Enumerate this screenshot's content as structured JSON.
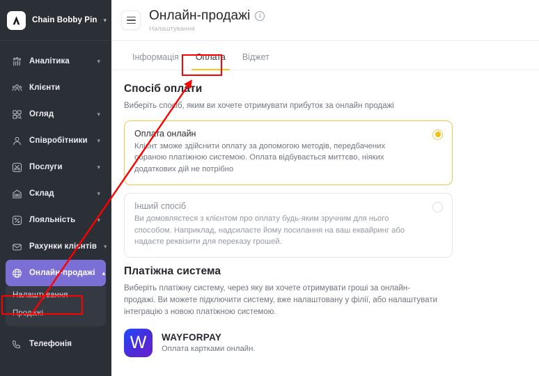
{
  "sidebar": {
    "brand": {
      "name": "Chain Bobby Pin",
      "chevron": "chevron-down"
    },
    "items": [
      {
        "label": "Аналітика",
        "icon": "analytics-icon",
        "has_chevron": true,
        "active": false
      },
      {
        "label": "Клієнти",
        "icon": "clients-icon",
        "has_chevron": false,
        "active": false
      },
      {
        "label": "Огляд",
        "icon": "overview-icon",
        "has_chevron": true,
        "active": false
      },
      {
        "label": "Співробітники",
        "icon": "employees-icon",
        "has_chevron": true,
        "active": false
      },
      {
        "label": "Послуги",
        "icon": "services-scissors-icon",
        "has_chevron": true,
        "active": false
      },
      {
        "label": "Склад",
        "icon": "warehouse-icon",
        "has_chevron": true,
        "active": false
      },
      {
        "label": "Лояльність",
        "icon": "loyalty-percent-icon",
        "has_chevron": true,
        "active": false
      },
      {
        "label": "Рахунки клієнтів",
        "icon": "client-accounts-icon",
        "has_chevron": true,
        "active": false
      },
      {
        "label": "Онлайн-продажі",
        "icon": "globe-icon",
        "has_chevron": true,
        "active": true
      },
      {
        "label": "Телефонія",
        "icon": "phone-icon",
        "has_chevron": false,
        "active": false
      }
    ],
    "subitems": [
      {
        "label": "Налаштування",
        "highlighted": true
      },
      {
        "label": "Продажі",
        "highlighted": false
      }
    ]
  },
  "topbar": {
    "menu_icon": "hamburger-icon",
    "title": "Онлайн-продажі",
    "info_icon": "info-circle-icon",
    "info_glyph": "i",
    "subtitle": "Налаштування"
  },
  "tabs": [
    {
      "label": "Інформація",
      "active": false
    },
    {
      "label": "Оплата",
      "active": true
    },
    {
      "label": "Віджет",
      "active": false
    }
  ],
  "payment_method": {
    "title": "Спосіб оплати",
    "description": "Виберіть спосіб, яким ви хочете отримувати прибуток за онлайн продажі",
    "options": [
      {
        "name": "Оплата онлайн",
        "text": "Клієнт зможе здійснити оплату за допомогою методів, передбачених обраною платіжною системою. Оплата відбувається миттєво, ніяких додаткових дій не потрібно",
        "selected": true
      },
      {
        "name": "Інший спосіб",
        "text": "Ви домовляєтеся з клієнтом про оплату будь-яким зручним для нього способом. Наприклад, надсилаєте йому посилання на ваш еквайринг або надаєте реквізити для переказу грошей.",
        "selected": false
      }
    ]
  },
  "payment_system": {
    "title": "Платіжна система",
    "description": "Виберіть платіжну систему, через яку ви хочете отримувати гроші за онлайн-продажі. Ви можете підключити систему, вже налаштовану у філії, або налаштувати інтеграцію з новою платіжною системою.",
    "provider": {
      "logo_letter": "W",
      "name": "WAYFORPAY",
      "subtitle": "Оплата картками онлайн."
    }
  },
  "annotations": {
    "color": "#ff0000",
    "boxes": [
      "tab-oplata",
      "sidebar-nalashtuvannya"
    ],
    "arrow": "from-sidebar-settings-to-payment-tab"
  },
  "colors": {
    "sidebar_bg": "#2b2f36",
    "active_nav": "#7b6fd6",
    "accent_yellow": "#f5c518",
    "annotation_red": "#ff0000",
    "provider_gradient_start": "#1e4bff",
    "provider_gradient_end": "#6a1fd0"
  }
}
